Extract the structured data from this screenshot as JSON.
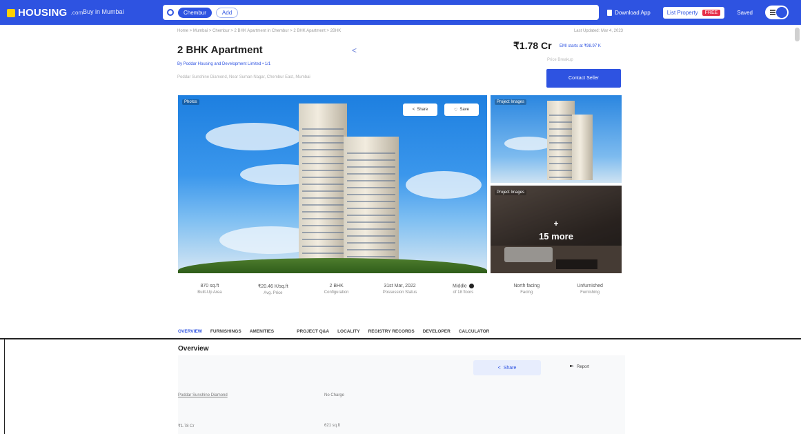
{
  "topbar": {
    "logo": "HOUSING",
    "logo_suffix": ".com",
    "city_selector": "Buy in Mumbai",
    "search_chip": "Chembur",
    "search_add": "Add",
    "download_app": "Download App",
    "list_property": "List Property",
    "list_badge": "FREE",
    "saved": "Saved",
    "brand_color": "#2e53e1"
  },
  "breadcrumb": "Home > Mumbai > Chembur > 2 BHK Apartment in Chembur > 2 BHK Apartment > 2BHK",
  "last_updated": "Last Updated: Mar 4, 2023",
  "property": {
    "title": "2 BHK Apartment",
    "developer": "By Poddar Housing and Development Limited • 1/1",
    "address": "Poddar Sunshine Diamond, Near Suman Nagar, Chembur East, Mumbai",
    "price": "₹1.78 Cr",
    "emi": "EMI starts at ₹98.97 K",
    "sub_price": "Price Breakup",
    "contact_button": "Contact Seller"
  },
  "gallery": {
    "main_tag": "Photos",
    "share_label": "Share",
    "save_label": "Save",
    "side_tag_1": "Project Images",
    "side_tag_2": "Project Images",
    "more_plus": "+",
    "more_label": "15 more"
  },
  "stats": [
    {
      "value": "870 sq.ft",
      "label": "Built-Up Area"
    },
    {
      "value": "₹20.46 K/sq.ft",
      "label": "Avg. Price"
    },
    {
      "value": "2 BHK",
      "label": "Configuration"
    },
    {
      "value": "31st Mar, 2022",
      "label": "Possession Status"
    },
    {
      "value": "Middle",
      "label": "of 18 floors"
    },
    {
      "value": "North facing",
      "label": "Facing"
    },
    {
      "value": "Unfurnished",
      "label": "Furnishing"
    }
  ],
  "tabs": [
    "OVERVIEW",
    "FURNISHINGS",
    "AMENITIES",
    "PROJECT Q&A",
    "LOCALITY",
    "REGISTRY RECORDS",
    "DEVELOPER",
    "CALCULATOR"
  ],
  "overview": {
    "title": "Overview",
    "share": "Share",
    "report": "Report",
    "row1_left": "Poddar Sunshine Diamond",
    "row1_right": "No Charge",
    "row2_left": "₹1.78 Cr",
    "row2_right": "621 sq.ft"
  }
}
